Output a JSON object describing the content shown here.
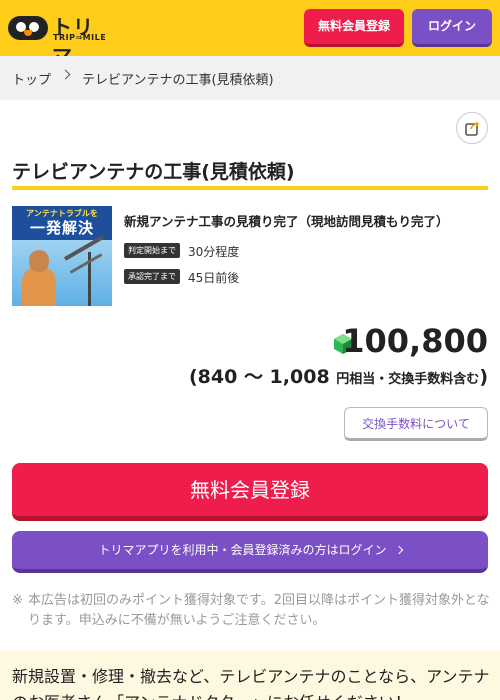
{
  "header": {
    "logo_text": "トリマ",
    "logo_sub": "TRIP⇒MILE",
    "signup_label": "無料会員登録",
    "login_label": "ログイン"
  },
  "breadcrumb": {
    "home": "トップ",
    "current": "テレビアンテナの工事(見積依頼)"
  },
  "page": {
    "title": "テレビアンテナの工事(見積依頼)"
  },
  "offer": {
    "banner_line1": "アンテナトラブルを",
    "banner_line2": "一発解決",
    "name": "新規アンテナ工事の見積り完了（現地訪問見積もり完了）",
    "tags": [
      {
        "label": "判定開始まで",
        "value": "30分程度"
      },
      {
        "label": "承認完了まで",
        "value": "45日前後"
      }
    ],
    "points": "100,800",
    "yen_open": "(",
    "yen_range": "840 〜 1,008",
    "yen_suffix": "円相当・交換手数料含む",
    "yen_close": ")"
  },
  "buttons": {
    "fee_label": "交換手数料について",
    "signup_main": "無料会員登録",
    "login_main": "トリマアプリを利用中・会員登録済みの方はログイン"
  },
  "notice": {
    "mark": "※",
    "text": "本広告は初回のみポイント獲得対象です。2回目以降はポイント獲得対象外となります。申込みに不備が無いようご注意ください。"
  },
  "description": {
    "text": "新規設置・修理・撤去など、テレビアンテナのことなら、アンテナのお医者さん「アンテナドクター」にお任せください！"
  },
  "colors": {
    "header_bg": "#ffcc1a",
    "signup": "#ee1d4c",
    "login": "#7b4fc6",
    "gem": "#2db84f"
  },
  "icons": {
    "share": "share-icon",
    "gem": "gem-icon",
    "breadcrumb_sep": "chevron-right-icon"
  }
}
